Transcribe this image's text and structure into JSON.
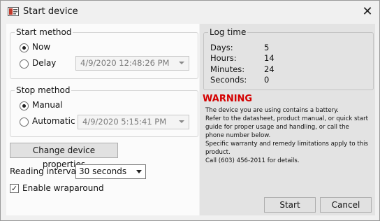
{
  "window": {
    "title": "Start device",
    "close_glyph": "✕"
  },
  "start_method": {
    "legend": "Start method",
    "options": [
      {
        "label": "Now",
        "selected": true
      },
      {
        "label": "Delay",
        "selected": false
      }
    ],
    "delay_datetime": "4/9/2020 12:48:26 PM"
  },
  "stop_method": {
    "legend": "Stop method",
    "options": [
      {
        "label": "Manual",
        "selected": true
      },
      {
        "label": "Automatic",
        "selected": false
      }
    ],
    "auto_datetime": "4/9/2020 5:15:41 PM"
  },
  "change_props_label": "Change device properties",
  "reading_interval": {
    "label": "Reading interval:",
    "value": "30 seconds"
  },
  "wraparound": {
    "label": "Enable wraparound",
    "checked": true
  },
  "log_time": {
    "legend": "Log time",
    "rows": [
      {
        "label": "Days:",
        "value": "5"
      },
      {
        "label": "Hours:",
        "value": "14"
      },
      {
        "label": "Minutes:",
        "value": "24"
      },
      {
        "label": "Seconds:",
        "value": "0"
      }
    ]
  },
  "warning": {
    "heading": "WARNING",
    "lines": [
      "The device you are using contains a battery.",
      "Refer to the datasheet, product manual, or quick start",
      "guide for proper usage and handling, or call the",
      "phone number below.",
      "Specific warranty and remedy limitations apply to this",
      "product.",
      "Call (603) 456-2011 for details."
    ]
  },
  "buttons": {
    "start": "Start",
    "cancel": "Cancel"
  },
  "colors": {
    "warning": "#d40000",
    "dialog_bg": "#f0f0f0",
    "right_panel_bg": "#e3e3e3"
  },
  "icons": {
    "app": "device-app-icon",
    "close": "close-icon",
    "check": "checkmark-icon"
  }
}
